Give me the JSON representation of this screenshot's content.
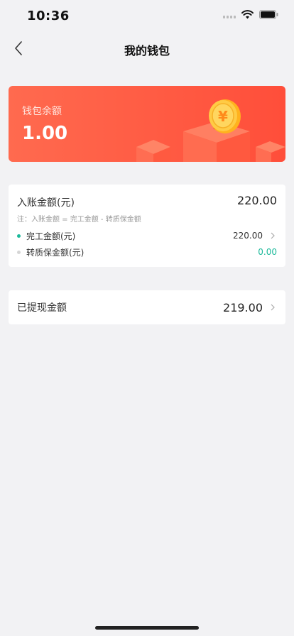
{
  "status_bar": {
    "time": "10:36"
  },
  "nav": {
    "title": "我的钱包"
  },
  "balance": {
    "label": "钱包余额",
    "value": "1.00",
    "coin_symbol": "¥"
  },
  "income": {
    "title": "入账金额(元)",
    "amount": "220.00",
    "note": "注：入账金额 = 完工金额 - 转质保金额",
    "rows": [
      {
        "label": "完工金额(元)",
        "value": "220.00"
      },
      {
        "label": "转质保金额(元)",
        "value": "0.00"
      }
    ]
  },
  "withdrawn": {
    "label": "已提现金额",
    "value": "219.00"
  },
  "colors": {
    "accent_red": "#ff5b43",
    "accent_green": "#1bb99a",
    "background": "#f2f2f4"
  }
}
